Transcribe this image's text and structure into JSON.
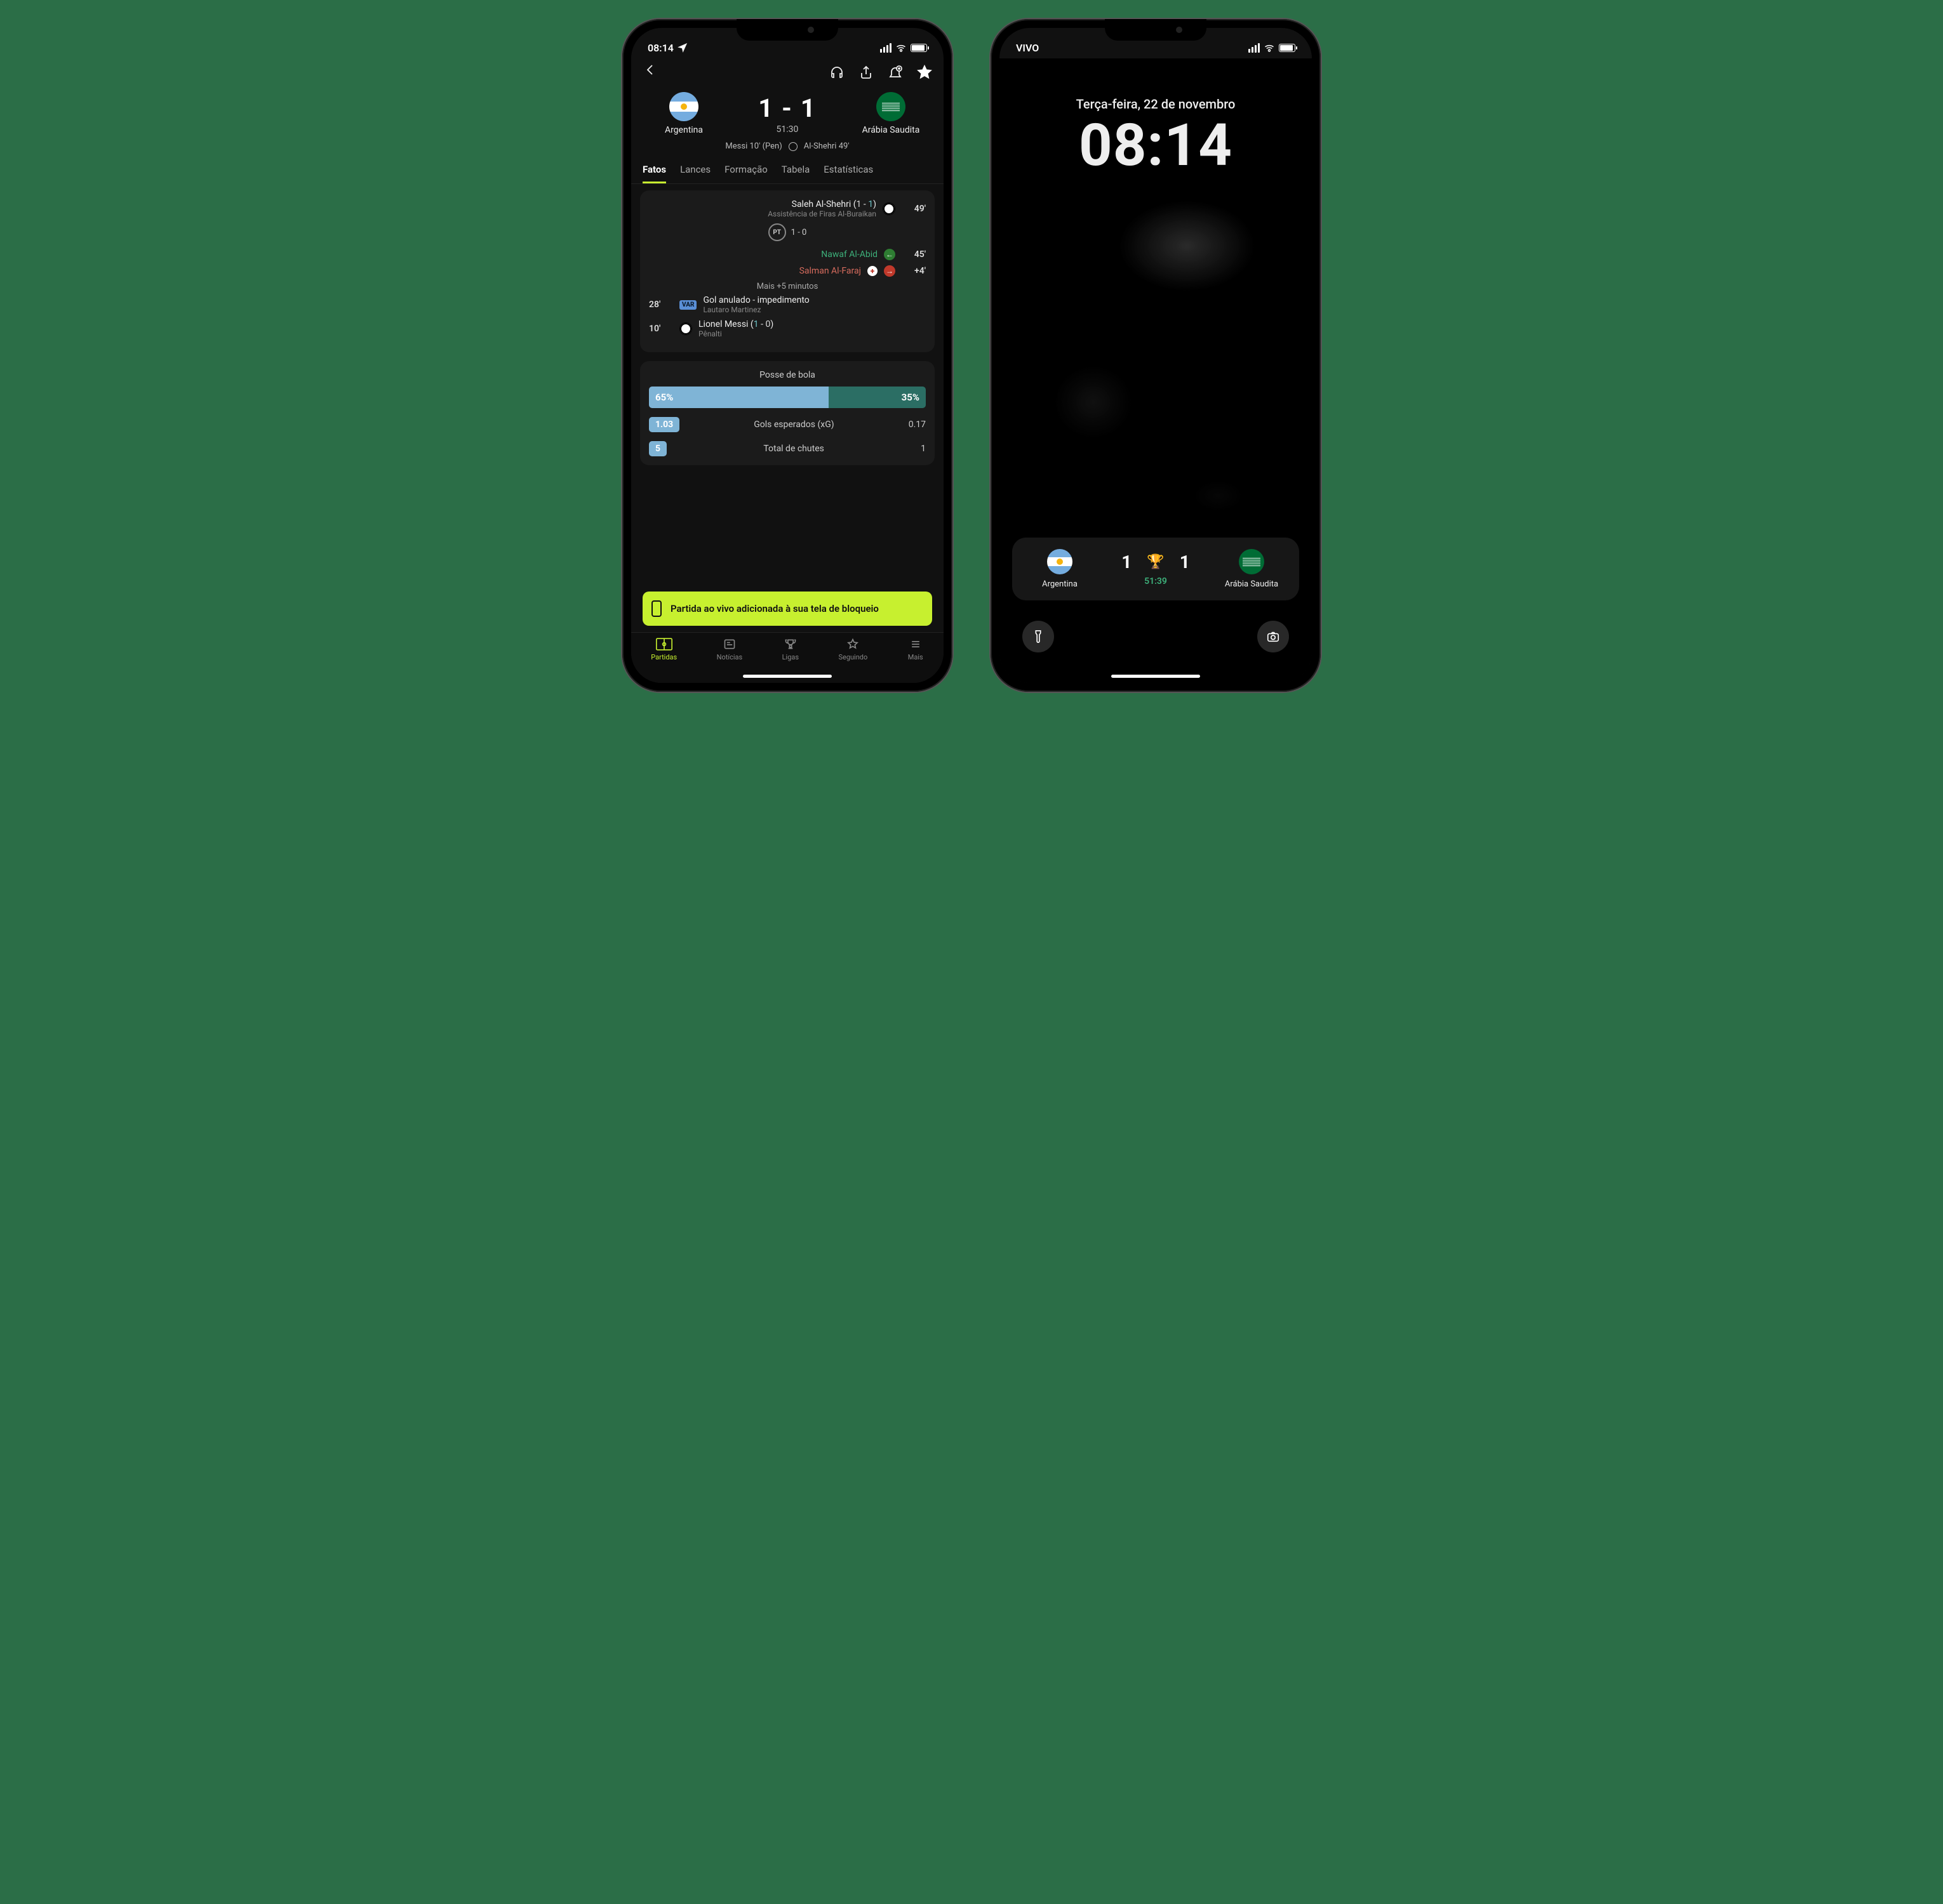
{
  "left_phone": {
    "status": {
      "time": "08:14",
      "carrier": ""
    },
    "header": {
      "home_team": "Argentina",
      "away_team": "Arábia Saudita",
      "home_score": "1",
      "away_score": "1",
      "score_display": "1 - 1",
      "clock": "51:30",
      "scorer_home": "Messi 10' (Pen)",
      "scorer_away": "Al-Shehri 49'"
    },
    "tabs": [
      "Fatos",
      "Lances",
      "Formação",
      "Tabela",
      "Estatísticas"
    ],
    "events": {
      "e49_main": "Saleh Al-Shehri (1 - 1)",
      "e49_sub": "Assistência de Firas Al-Buraikan",
      "e49_min": "49'",
      "pt_label": "PT",
      "pt_score": "1 - 0",
      "sub_in_name": "Nawaf Al-Abid",
      "sub_in_min": "45'",
      "sub_out_name": "Salman Al-Faraj",
      "sub_out_min": "+4'",
      "extra_time": "Mais +5 minutos",
      "var_min": "28'",
      "var_badge": "VAR",
      "var_main": "Gol anulado - impedimento",
      "var_sub": "Lautaro Martinez",
      "m10_min": "10'",
      "m10_main": "Lionel Messi (1 - 0)",
      "m10_sub": "Pênalti"
    },
    "stats": {
      "possession_title": "Posse de bola",
      "poss_home": "65%",
      "poss_away": "35%",
      "xg_label": "Gols esperados (xG)",
      "xg_home": "1.03",
      "xg_away": "0.17",
      "shots_label": "Total de chutes",
      "shots_home": "5",
      "shots_away": "1"
    },
    "toast": "Partida ao vivo adicionada à sua tela de bloqueio",
    "nav": {
      "matches": "Partidas",
      "news": "Notícias",
      "leagues": "Ligas",
      "following": "Seguindo",
      "more": "Mais"
    }
  },
  "right_phone": {
    "status": {
      "carrier": "VIVO"
    },
    "lock": {
      "date": "Terça-feira, 22 de novembro",
      "time": "08:14"
    },
    "widget": {
      "home_team": "Argentina",
      "away_team": "Arábia Saudita",
      "home_score": "1",
      "away_score": "1",
      "clock": "51:39"
    }
  },
  "chart_data": {
    "type": "bar",
    "title": "Posse de bola",
    "categories": [
      "Argentina",
      "Arábia Saudita"
    ],
    "values": [
      65,
      35
    ],
    "unit": "%",
    "extra_stats": [
      {
        "label": "Gols esperados (xG)",
        "home": 1.03,
        "away": 0.17
      },
      {
        "label": "Total de chutes",
        "home": 5,
        "away": 1
      }
    ]
  }
}
